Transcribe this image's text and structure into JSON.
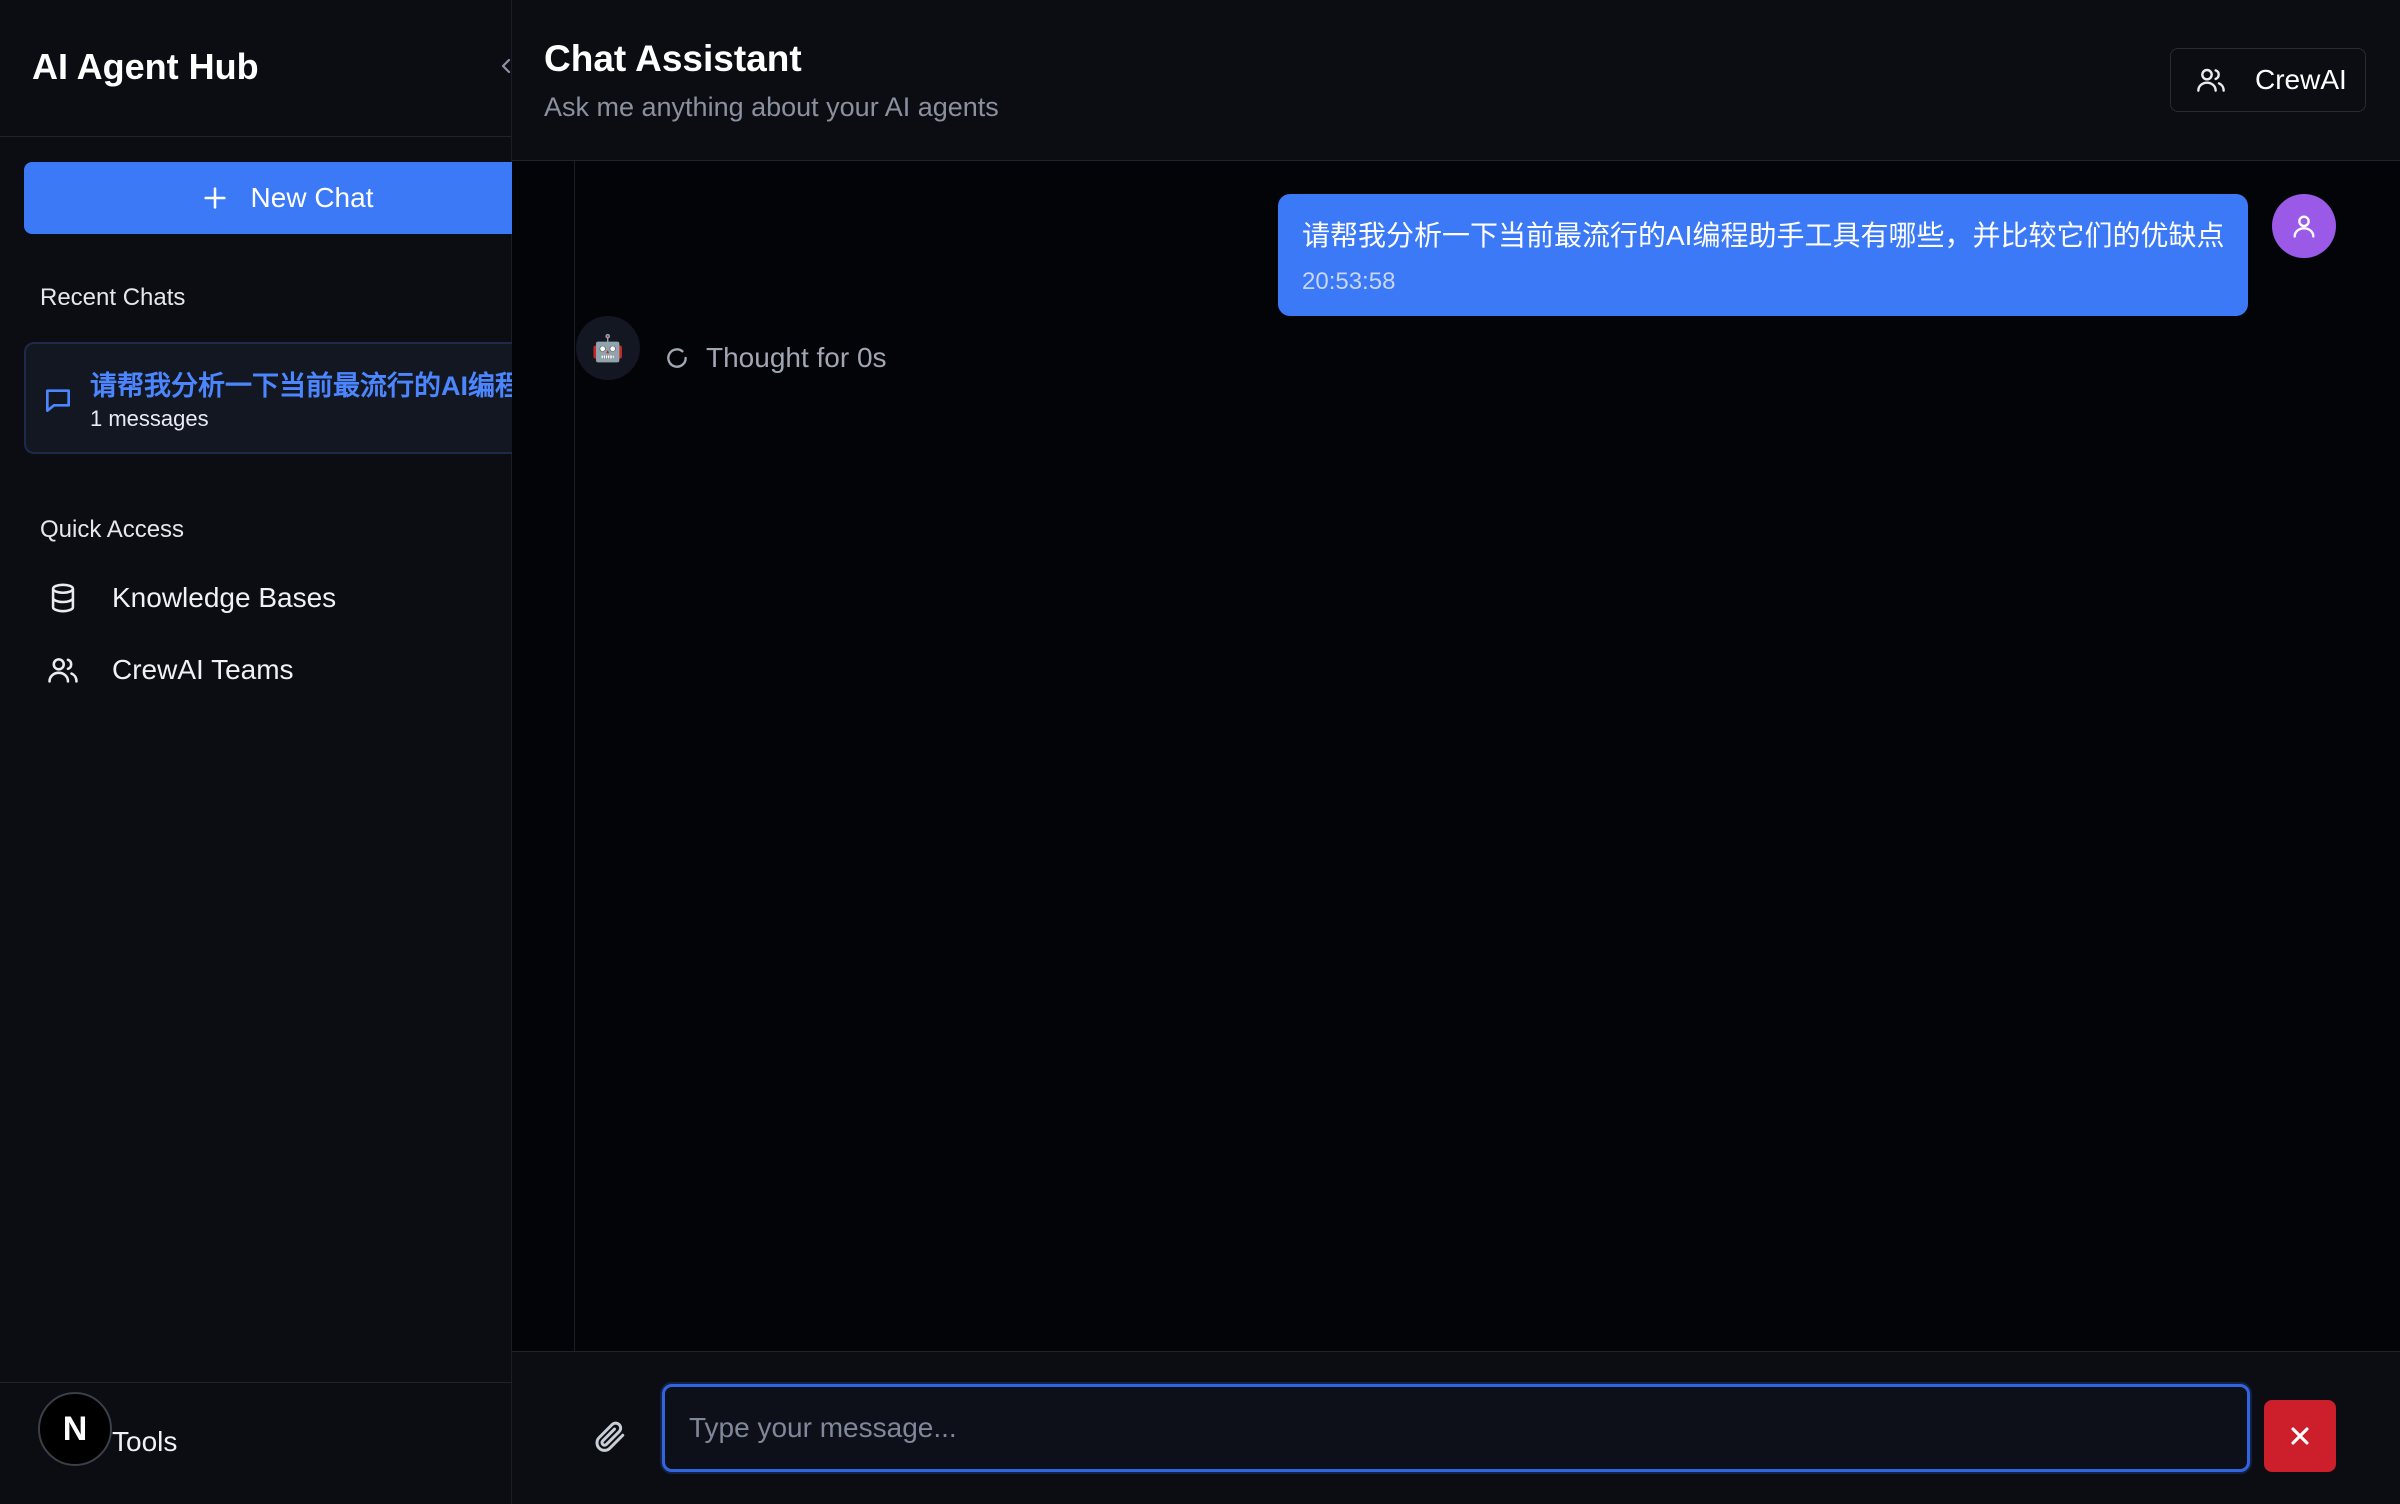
{
  "sidebar": {
    "app_title": "AI Agent Hub",
    "new_chat_label": "New Chat",
    "recent_label": "Recent Chats",
    "recent_chats": [
      {
        "title": "请帮我分析一下当前最流行的AI编程助",
        "count": "1 messages"
      }
    ],
    "quick_access_label": "Quick Access",
    "quick_access": [
      {
        "label": "Knowledge Bases",
        "icon": "database-icon"
      },
      {
        "label": "CrewAI Teams",
        "icon": "users-icon"
      }
    ],
    "footer": {
      "badge": "N",
      "label": "Tools"
    }
  },
  "header": {
    "title": "Chat Assistant",
    "subtitle": "Ask me anything about your AI agents",
    "crew_button": "CrewAI"
  },
  "messages": [
    {
      "role": "user",
      "text": "请帮我分析一下当前最流行的AI编程助手工具有哪些，并比较它们的优缺点",
      "time": "20:53:58"
    }
  ],
  "assistant": {
    "status": "Thought for 0s",
    "avatar": "🤖"
  },
  "composer": {
    "placeholder": "Type your message..."
  },
  "colors": {
    "accent": "#3b79f6",
    "stop": "#cc1f2b",
    "user_avatar": "#9b59e8"
  }
}
